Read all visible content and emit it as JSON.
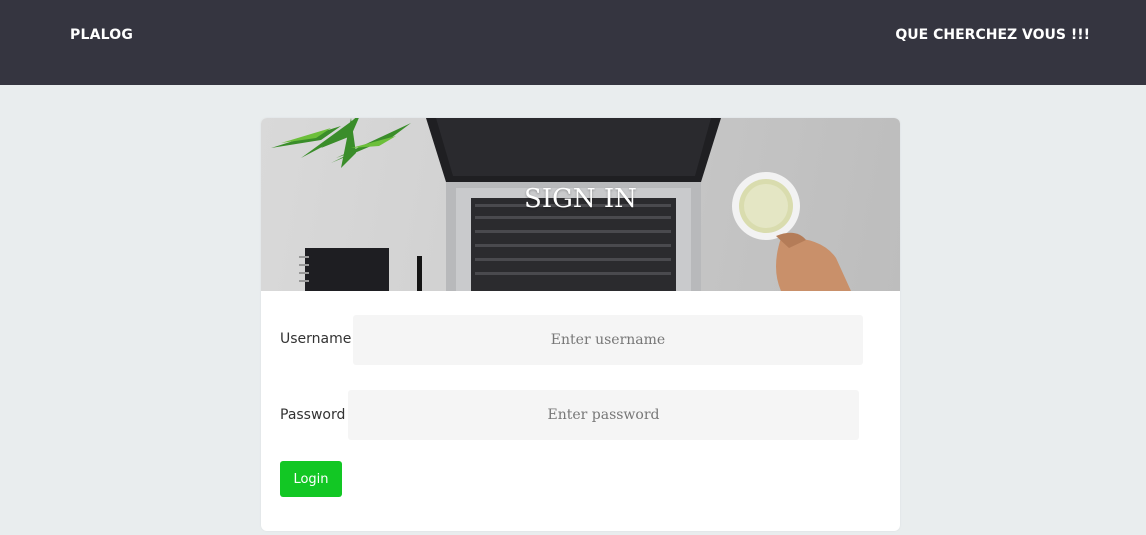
{
  "navbar": {
    "brand": "PLALOG",
    "right_link": "QUE CHERCHEZ VOUS !!!"
  },
  "login_card": {
    "title": "SIGN IN",
    "username_label": "Username",
    "username_placeholder": "Enter username",
    "password_label": "Password",
    "password_placeholder": "Enter password",
    "login_button": "Login"
  },
  "colors": {
    "navbar_bg": "#353540",
    "page_bg": "#e9edee",
    "login_button": "#12c724"
  }
}
